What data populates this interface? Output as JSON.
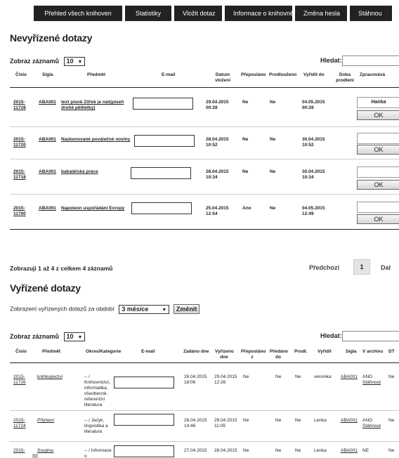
{
  "nav": [
    "Přehled všech knihoven",
    "Statistiky",
    "Vložit dotaz",
    "Informace o knihovně",
    "Změna hesla",
    "Stáhnou"
  ],
  "open": {
    "title": "Nevyřízené dotazy",
    "show_label": "Zobraz záznamů",
    "show_value": "10",
    "search_label": "Hledat:",
    "headers": [
      "Číslo",
      "Sigla",
      "Předmět",
      "E-mail",
      "Datum vložení",
      "Přeposláno",
      "Prodlouženo",
      "Vyřídit do",
      "Doba prodlení",
      "Zpracovává"
    ],
    "rows": [
      {
        "id": "2015-11728",
        "sigla": "ABA001",
        "subject": "text písně Zítřek je náš(píseň druhé pětiletky)",
        "date": "29.04.2015 00:28",
        "fwd": "Ne",
        "ext": "Ne",
        "due": "04.05.2015 00:28",
        "worker": "Hanka",
        "ok": "OK"
      },
      {
        "id": "2015-11720",
        "sigla": "ABA001",
        "subject": "Naskenované poválečné noviny",
        "date": "28.04.2015 10:52",
        "fwd": "Ne",
        "ext": "Ne",
        "due": "30.04.2015 10:52",
        "worker": "",
        "ok": "OK"
      },
      {
        "id": "2015-11718",
        "sigla": "ABA001",
        "subject": "bakalářská práce",
        "date": "28.04.2015 10:34",
        "fwd": "Ne",
        "ext": "Ne",
        "due": "30.04.2015 10:34",
        "worker": "",
        "ok": "OK"
      },
      {
        "id": "2015-11700",
        "sigla": "ABA001",
        "subject": "Napoleon uspořádání Evropy",
        "date": "25.04.2015 12:54",
        "fwd": "Ano",
        "ext": "Ne",
        "due": "04.05.2015 12:49",
        "worker": "",
        "ok": "OK"
      }
    ],
    "info": "Zobrazuji 1 až 4 z celkem 4 záznamů",
    "prev": "Předchozí",
    "page": "1",
    "next": "Dal"
  },
  "done": {
    "title": "Vyřízené dotazy",
    "period_label": "Zobrazení vyřízených dotazů za období",
    "period_value": "3 měsíce",
    "change_btn": "Změnit",
    "show_label": "Zobraz záznamů",
    "show_value": "10",
    "search_label": "Hledat:",
    "headers": [
      "Číslo",
      "Předmět",
      "Okres/Kategorie",
      "E-mail",
      "Zadáno dne",
      "Vyřízeno dne",
      "Přeposláno z",
      "Předáno do",
      "Prodl.",
      "Vyřídil",
      "Sigla",
      "V archivu",
      "DT"
    ],
    "rows": [
      {
        "id": "2015-11726",
        "subject": "knihkupectví",
        "cat": "-- / Knihovnictví, informatika, všeobecné, referenční literatura",
        "entered": "28.04.2015 18:06",
        "resolved": "29.04.2015 12:26",
        "fwd": "Ne",
        "passed": "Ne",
        "ext": "Ne",
        "who": "veronika",
        "sigla": "ABA001",
        "arch": "ANO",
        "arch_link": "Stáhnout",
        "dt": "Ne"
      },
      {
        "id": "2015-11724",
        "subject": "Příjmení",
        "cat": "-- / Jazyk, lingvistika a literatura",
        "entered": "28.04.2015 14:46",
        "resolved": "29.04.2015 11:09",
        "fwd": "Ne",
        "passed": "Ne",
        "ext": "Ne",
        "who": "Lenka",
        "sigla": "ABA001",
        "arch": "ANO",
        "arch_link": "Stáhnout",
        "dt": "Ne"
      },
      {
        "id": "2015-",
        "subject": "Soupisu",
        "cat": "-- / Informace o",
        "entered": "27.04.2015",
        "resolved": "28.04.2015",
        "fwd": "Ne",
        "passed": "Ne",
        "ext": "Ne",
        "who": "Lenka",
        "sigla": "ABA001",
        "arch": "NE",
        "arch_link": "",
        "dt": "Ne"
      }
    ]
  }
}
